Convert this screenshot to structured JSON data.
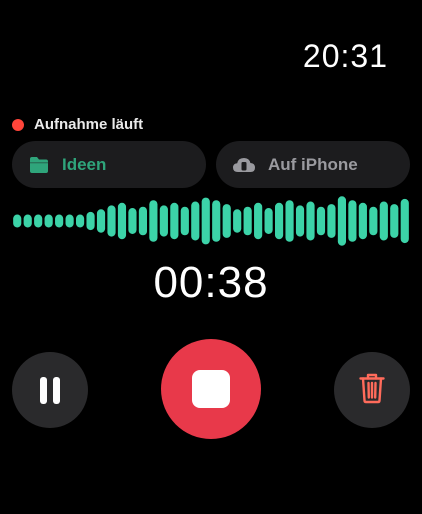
{
  "clock": {
    "time": "20:31"
  },
  "status": {
    "label": "Aufnahme läuft",
    "dot_color": "#ff453a"
  },
  "chips": {
    "folder": {
      "label": "Ideen",
      "icon": "folder-icon",
      "color": "#2fa57b"
    },
    "device": {
      "label": "Auf iPhone",
      "icon": "cloud-iphone-icon",
      "color": "#9a9a9f"
    }
  },
  "waveform": {
    "color": "#3cd3a8",
    "levels": [
      0.25,
      0.25,
      0.25,
      0.25,
      0.25,
      0.25,
      0.25,
      0.35,
      0.45,
      0.6,
      0.7,
      0.5,
      0.55,
      0.8,
      0.6,
      0.7,
      0.55,
      0.75,
      0.9,
      0.8,
      0.65,
      0.45,
      0.55,
      0.7,
      0.5,
      0.7,
      0.8,
      0.6,
      0.75,
      0.55,
      0.65,
      0.95,
      0.8,
      0.7,
      0.55,
      0.75,
      0.65,
      0.85
    ]
  },
  "timer": {
    "elapsed": "00:38"
  },
  "controls": {
    "pause": {
      "icon": "pause-icon"
    },
    "stop": {
      "icon": "stop-icon",
      "color": "#e8394a"
    },
    "delete": {
      "icon": "trash-icon",
      "color": "#ff6b5b"
    }
  }
}
